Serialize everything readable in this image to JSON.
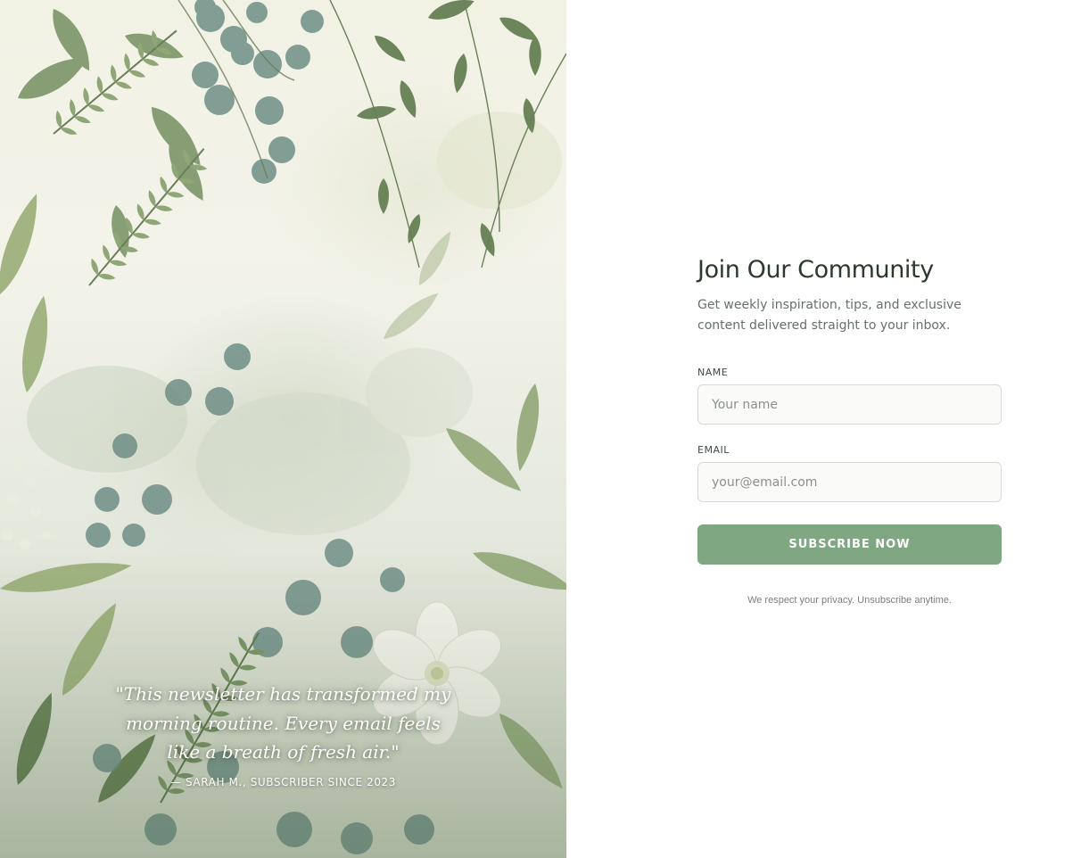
{
  "testimonial": {
    "quote": "\"This newsletter has transformed my morning routine. Every email feels like a breath of fresh air.\"",
    "author": "— SARAH M., SUBSCRIBER SINCE 2023"
  },
  "signup": {
    "title": "Join Our Community",
    "subtitle": "Get weekly inspiration, tips, and exclusive content delivered straight to your inbox.",
    "name_label": "NAME",
    "name_placeholder": "Your name",
    "name_value": "",
    "email_label": "EMAIL",
    "email_placeholder": "your@email.com",
    "email_value": "",
    "submit_label": "SUBSCRIBE NOW",
    "privacy_note": "We respect your privacy. Unsubscribe anytime."
  },
  "colors": {
    "accent": "#7fa882",
    "heading": "#2c3a2e",
    "body_text": "#65716a",
    "foliage_dark": "#4f6b44",
    "foliage_mid": "#7c9668",
    "foliage_light": "#aab98f",
    "eucalyptus": "#6f8f86"
  },
  "imagery": {
    "left_panel": "watercolor-botanical-illustration"
  }
}
